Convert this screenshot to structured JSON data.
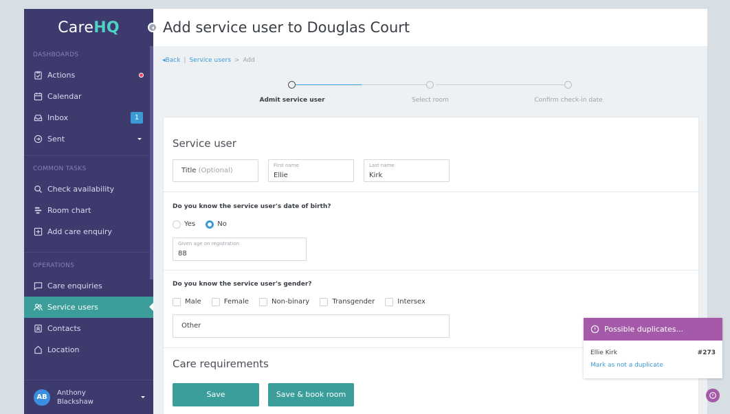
{
  "brand": {
    "logo_part1": "Care",
    "logo_part2": "HQ",
    "accent": "#4fd2c2"
  },
  "sidebar": {
    "sections": [
      {
        "label": "DASHBOARDS"
      },
      {
        "label": "COMMON TASKS"
      },
      {
        "label": "OPERATIONS"
      }
    ],
    "dashboards": [
      {
        "label": "Actions",
        "icon": "clipboard-check-icon",
        "indicator": "notification-dot"
      },
      {
        "label": "Calendar",
        "icon": "calendar-icon"
      },
      {
        "label": "Inbox",
        "icon": "inbox-icon",
        "badge": "1"
      },
      {
        "label": "Sent",
        "icon": "send-icon",
        "has_dropdown": true
      }
    ],
    "common_tasks": [
      {
        "label": "Check availability",
        "icon": "search-icon"
      },
      {
        "label": "Room chart",
        "icon": "room-chart-icon"
      },
      {
        "label": "Add care enquiry",
        "icon": "plus-square-icon"
      }
    ],
    "operations": [
      {
        "label": "Care enquiries",
        "icon": "chat-icon"
      },
      {
        "label": "Service users",
        "icon": "users-icon",
        "active": true
      },
      {
        "label": "Contacts",
        "icon": "contact-card-icon"
      },
      {
        "label": "Location",
        "icon": "home-icon"
      }
    ],
    "user": {
      "initials": "AB",
      "first": "Anthony",
      "last": "Blackshaw"
    }
  },
  "header": {
    "title": "Add service user to Douglas Court"
  },
  "breadcrumb": {
    "back": "Back",
    "parent": "Service users",
    "separator": ">",
    "current": "Add"
  },
  "stepper": {
    "steps": [
      {
        "label": "Admit service user",
        "current": true
      },
      {
        "label": "Select room",
        "current": false
      },
      {
        "label": "Confirm check-in date",
        "current": false
      }
    ]
  },
  "form": {
    "section_title": "Service user",
    "title_field": {
      "label": "Title",
      "hint": "(Optional)"
    },
    "first_name": {
      "label": "First name",
      "value": "Ellie"
    },
    "last_name": {
      "label": "Last name",
      "value": "Kirk"
    },
    "dob_question": "Do you know the service user's date of birth?",
    "dob_options": [
      {
        "label": "Yes",
        "checked": false
      },
      {
        "label": "No",
        "checked": true
      }
    ],
    "age_field": {
      "label": "Given age on registration",
      "value": "88"
    },
    "gender_question": "Do you know the service user's gender?",
    "gender_options": [
      {
        "label": "Male"
      },
      {
        "label": "Female"
      },
      {
        "label": "Non-binary"
      },
      {
        "label": "Transgender"
      },
      {
        "label": "Intersex"
      }
    ],
    "other_placeholder": "Other",
    "care_title": "Care requirements",
    "save_label": "Save",
    "save_book_label": "Save & book room",
    "button_color": "#3c9e9b"
  },
  "duplicates": {
    "header": "Possible duplicates...",
    "name": "Ellie Kirk",
    "id": "#273",
    "action": "Mark as not a duplicate",
    "color": "#a45aa8"
  }
}
